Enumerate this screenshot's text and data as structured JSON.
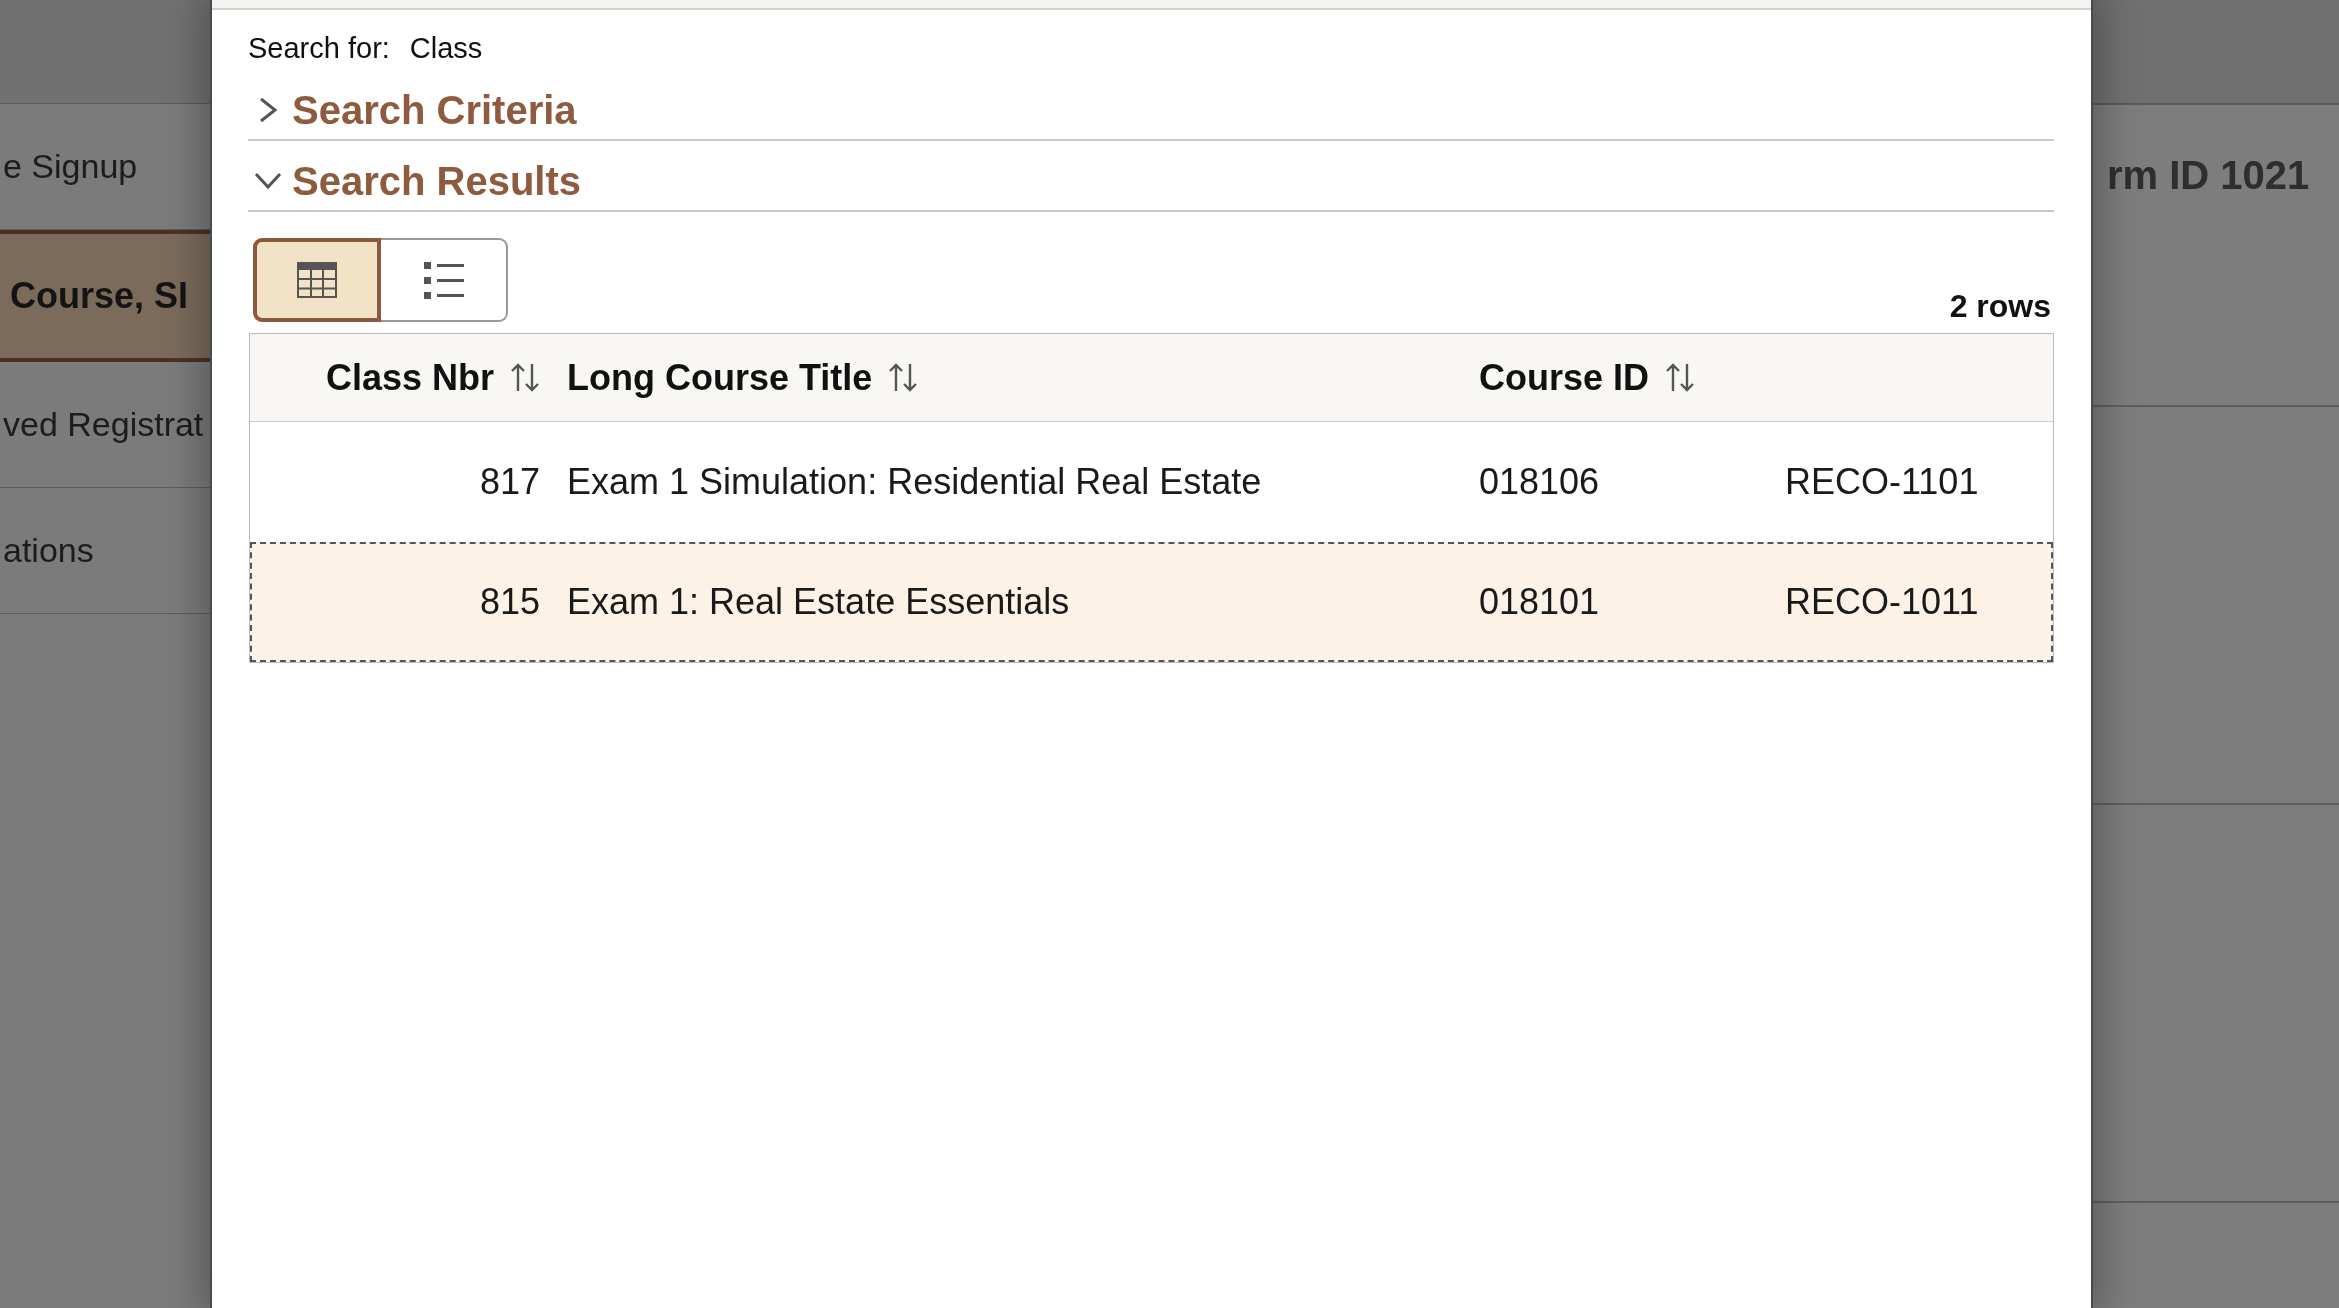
{
  "background_page": {
    "nav_items": [
      {
        "label": "e Signup",
        "selected": false
      },
      {
        "label": "Course, SI",
        "selected": true
      },
      {
        "label": "ved Registrat",
        "selected": false
      },
      {
        "label": "ations",
        "selected": false
      }
    ],
    "form_heading": "rm ID 1021"
  },
  "dialog": {
    "search_for": {
      "label": "Search for:",
      "value": "Class"
    },
    "sections": [
      {
        "title": "Search Criteria",
        "expanded": false
      },
      {
        "title": "Search Results",
        "expanded": true,
        "view_toggle": [
          {
            "kind": "grid",
            "selected": true
          },
          {
            "kind": "list",
            "selected": false
          }
        ],
        "row_count": "2 rows",
        "table": {
          "columns": [
            {
              "label": "Class Nbr",
              "sortable": true
            },
            {
              "label": "Long Course Title",
              "sortable": true
            },
            {
              "label": "Course ID",
              "sortable": true
            }
          ],
          "rows": [
            {
              "cells": [
                "817",
                "Exam 1 Simulation: Residential Real Estate",
                "018106",
                "RECO-1101"
              ],
              "selected": false
            },
            {
              "cells": [
                "815",
                "Exam 1: Real Estate Essentials",
                "018101",
                "RECO-1011"
              ],
              "selected": true
            }
          ]
        }
      }
    ]
  }
}
